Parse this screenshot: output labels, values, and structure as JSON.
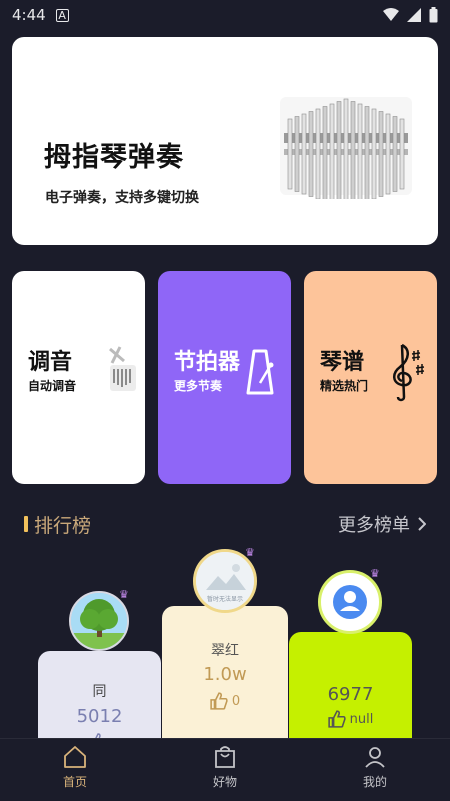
{
  "status_bar": {
    "time": "4:44",
    "a_icon": "A"
  },
  "hero": {
    "title": "拇指琴弹奏",
    "subtitle": "电子弹奏，支持多键切换"
  },
  "tools": [
    {
      "title": "调音",
      "subtitle": "自动调音",
      "icon": "kalimba-small-icon",
      "bg": "#ffffff"
    },
    {
      "title": "节拍器",
      "subtitle": "更多节奏",
      "icon": "metronome-icon",
      "bg": "#8f66f7"
    },
    {
      "title": "琴谱",
      "subtitle": "精选热门",
      "icon": "music-clef-icon",
      "bg": "#fdc49a"
    }
  ],
  "ranking": {
    "title": "排行榜",
    "more": "更多榜单",
    "entries": [
      {
        "rank": 2,
        "name": "同",
        "score": "5012",
        "likes": ""
      },
      {
        "rank": 1,
        "name": "翠红",
        "score": "1.0w",
        "likes": "0",
        "avatar_text": "暂时无法显示"
      },
      {
        "rank": 3,
        "name": "",
        "score": "6977",
        "likes": "null"
      }
    ]
  },
  "nav": [
    {
      "label": "首页",
      "icon": "home-icon",
      "active": true
    },
    {
      "label": "好物",
      "icon": "shopping-bag-icon",
      "active": false
    },
    {
      "label": "我的",
      "icon": "profile-icon",
      "active": false
    }
  ],
  "colors": {
    "accent": "#d9b37b",
    "purple": "#8f66f7",
    "peach": "#fdc49a",
    "lime": "#c5f000",
    "background": "#1b1c2a"
  }
}
